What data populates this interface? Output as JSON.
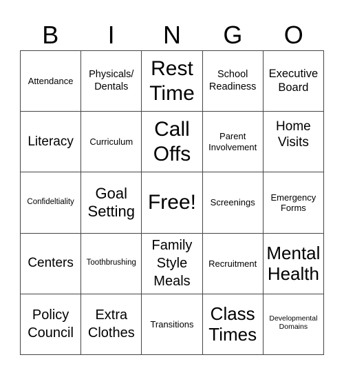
{
  "header": {
    "letters": [
      "B",
      "I",
      "N",
      "G",
      "O"
    ]
  },
  "cells": [
    [
      "Attendance",
      "Physicals/ Dentals",
      "Rest Time",
      "School Readiness",
      "Executive Board"
    ],
    [
      "Literacy",
      "Curriculum",
      "Call Offs",
      "Parent Involvement",
      "Home Visits"
    ],
    [
      "Confideltiality",
      "Goal Setting",
      "Free!",
      "Screenings",
      "Emergency Forms"
    ],
    [
      "Centers",
      "Toothbrushing",
      "Family Style Meals",
      "Recruitment",
      "Mental Health"
    ],
    [
      "Policy Council",
      "Extra Clothes",
      "Transitions",
      "Class Times",
      "Developmental Domains"
    ]
  ]
}
